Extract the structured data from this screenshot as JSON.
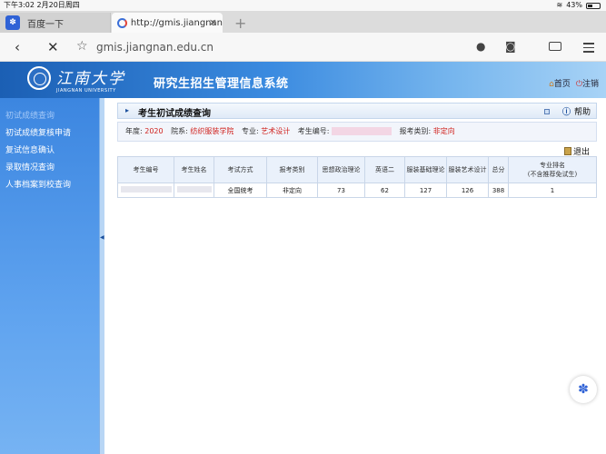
{
  "status_bar": {
    "time": "下午3:02",
    "date": "2月20日周四",
    "battery": "43%"
  },
  "browser": {
    "tabs": [
      {
        "label": "百度一下"
      },
      {
        "label": "http://gmis.jiangnan"
      }
    ],
    "url": "gmis.jiangnan.edu.cn"
  },
  "header": {
    "university_cn": "江南大学",
    "university_en": "JIANGNAN UNIVERSITY",
    "system_title": "研究生招生管理信息系统",
    "home_label": "首页",
    "logout_label": "注销"
  },
  "sidebar": {
    "items": [
      {
        "label": "初试成绩查询"
      },
      {
        "label": "初试成绩复核申请"
      },
      {
        "label": "复试信息确认"
      },
      {
        "label": "录取情况查询"
      },
      {
        "label": "人事档案到校查询"
      }
    ]
  },
  "content": {
    "title": "考生初试成绩查询",
    "help_label": "帮助",
    "exit_label": "退出",
    "info": {
      "year_label": "年度:",
      "year_value": "2020",
      "dept_label": "院系:",
      "dept_value": "纺织服装学院",
      "major_label": "专业:",
      "major_value": "艺术设计",
      "exam_no_label": "考生编号:",
      "type_label": "报考类别:",
      "type_value": "非定向"
    },
    "table": {
      "headers": [
        "考生编号",
        "考生姓名",
        "考试方式",
        "报考类别",
        "思想政治理论",
        "英语二",
        "服装基础理论",
        "服装艺术设计",
        "总分",
        "专业排名",
        "(不含推荐免试生)"
      ],
      "row": {
        "exam_mode": "全国统考",
        "type": "非定向",
        "politics": "73",
        "english": "62",
        "basic_theory": "127",
        "art_design": "126",
        "total": "388",
        "rank": "1"
      }
    }
  }
}
